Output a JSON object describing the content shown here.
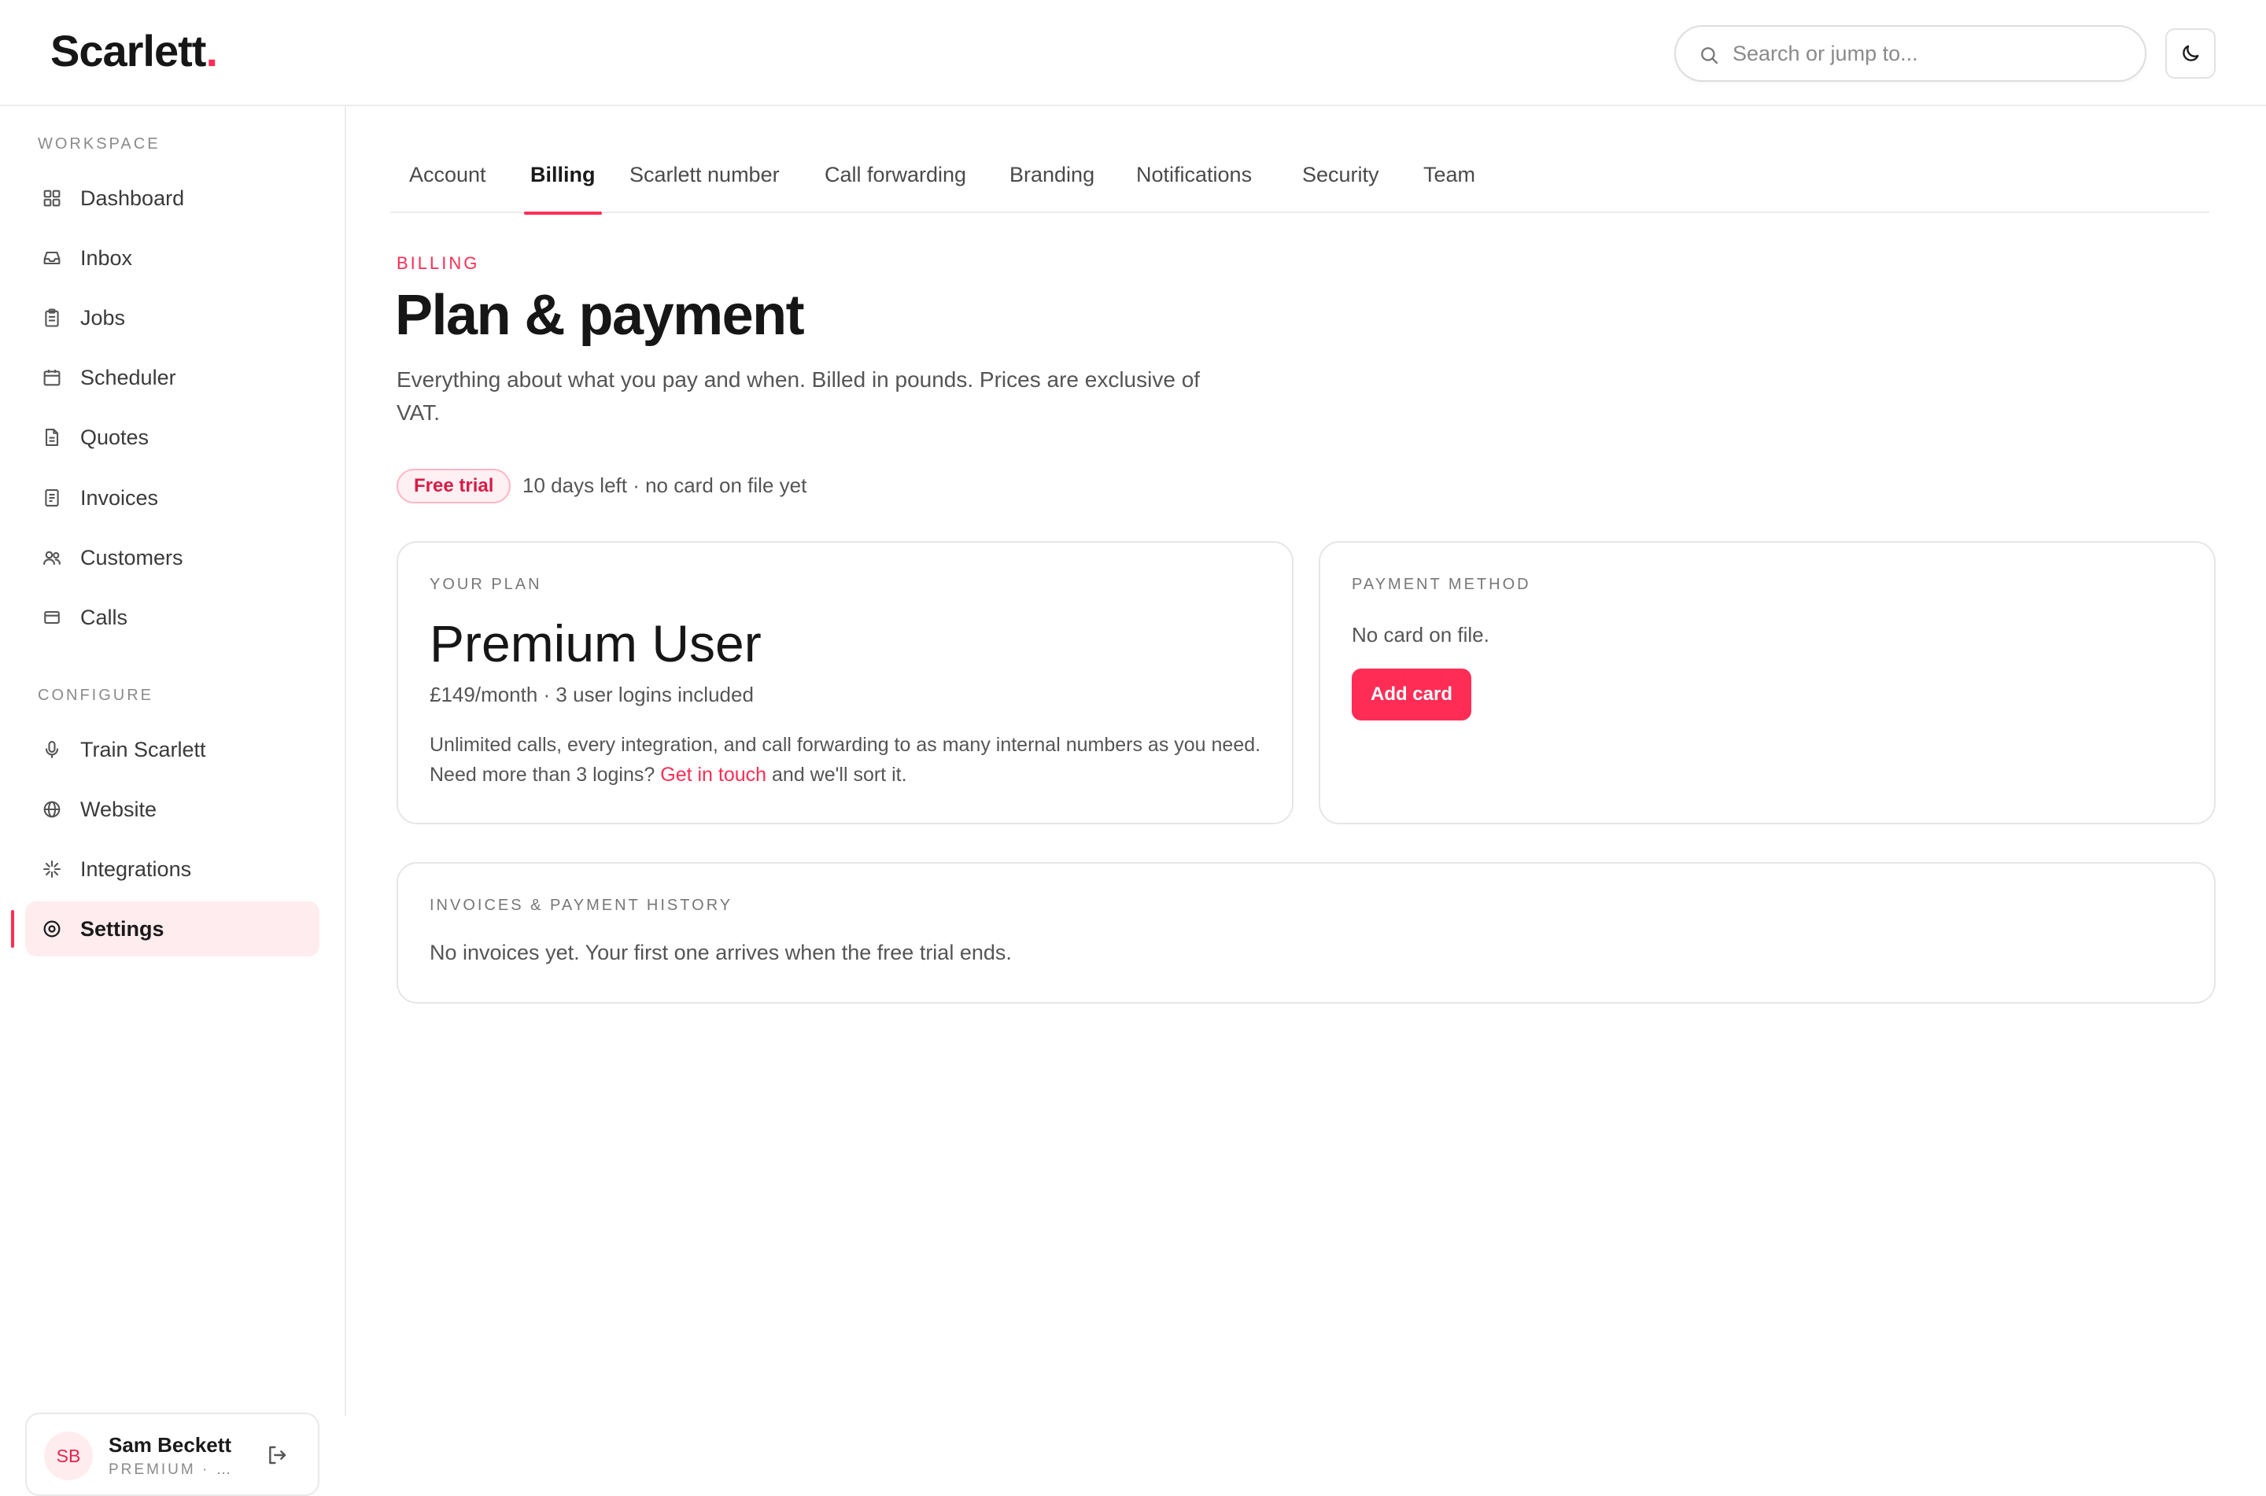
{
  "brand": {
    "name": "Scarlett",
    "dot": ".",
    "accent": "#ff2d55"
  },
  "search": {
    "placeholder": "Search or jump to..."
  },
  "sidebar": {
    "workspace_label": "WORKSPACE",
    "workspace_items": [
      {
        "label": "Dashboard",
        "icon": "grid-icon"
      },
      {
        "label": "Inbox",
        "icon": "inbox-icon"
      },
      {
        "label": "Jobs",
        "icon": "clipboard-icon"
      },
      {
        "label": "Scheduler",
        "icon": "calendar-icon"
      },
      {
        "label": "Quotes",
        "icon": "document-icon"
      },
      {
        "label": "Invoices",
        "icon": "receipt-icon"
      },
      {
        "label": "Customers",
        "icon": "users-icon"
      },
      {
        "label": "Calls",
        "icon": "phone-card-icon"
      }
    ],
    "configure_label": "CONFIGURE",
    "configure_items": [
      {
        "label": "Train Scarlett",
        "icon": "microphone-icon"
      },
      {
        "label": "Website",
        "icon": "globe-icon"
      },
      {
        "label": "Integrations",
        "icon": "sparkle-icon"
      },
      {
        "label": "Settings",
        "icon": "settings-icon",
        "active": true
      }
    ]
  },
  "user": {
    "initials": "SB",
    "name": "Sam Beckett",
    "plan": "PREMIUM · S..."
  },
  "tabs": [
    {
      "label": "Account"
    },
    {
      "label": "Billing",
      "active": true
    },
    {
      "label": "Scarlett number"
    },
    {
      "label": "Call forwarding"
    },
    {
      "label": "Branding"
    },
    {
      "label": "Notifications"
    },
    {
      "label": "Security"
    },
    {
      "label": "Team"
    }
  ],
  "page": {
    "eyebrow": "BILLING",
    "title": "Plan & payment",
    "description": "Everything about what you pay and when. Billed in pounds. Prices are exclusive of VAT.",
    "trial_badge": "Free trial",
    "trial_text": "10 days left · no card on file yet"
  },
  "plan": {
    "label": "YOUR PLAN",
    "name": "Premium User",
    "price": "£149/month · 3 user logins included",
    "desc_before": "Unlimited calls, every integration, and call forwarding to as many internal numbers as you need. Need more than 3 logins? ",
    "desc_link": "Get in touch",
    "desc_after": " and we'll sort it."
  },
  "payment": {
    "label": "PAYMENT METHOD",
    "text": "No card on file.",
    "button": "Add card"
  },
  "invoices": {
    "label": "INVOICES & PAYMENT HISTORY",
    "text": "No invoices yet. Your first one arrives when the free trial ends."
  }
}
